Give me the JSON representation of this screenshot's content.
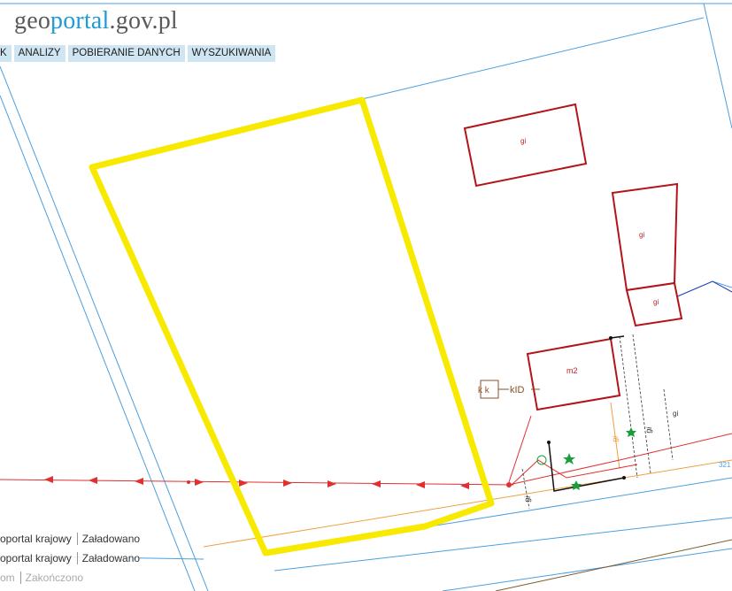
{
  "logo": {
    "brand_prefix": "geo",
    "brand_accent": "portal",
    "brand_suffix": ".gov.pl"
  },
  "menu": [
    {
      "label": "K"
    },
    {
      "label": "ANALIZY"
    },
    {
      "label": "POBIERANIE DANYCH"
    },
    {
      "label": "WYSZUKIWANIA"
    }
  ],
  "map_labels": {
    "building1": "gi",
    "building2": "gi",
    "building3": "gi",
    "building4": "m2",
    "kk": "k k",
    "kid": "kID",
    "ge1": "gi",
    "ge2": "gi",
    "ge3": "gi",
    "ge4": "gi",
    "edge_num": "321"
  },
  "layer_status": [
    {
      "source": "oportal krajowy",
      "status": "Załadowano"
    },
    {
      "source": "oportal krajowy",
      "status": "Załadowano"
    },
    {
      "source": "om",
      "status": "Zakończono"
    }
  ],
  "colors": {
    "highlight": "#f7e900",
    "parcel_line": "#4a9fe0",
    "building": "#b3141a",
    "utility_line": "#e03030",
    "accent": "#1f9bd1"
  }
}
